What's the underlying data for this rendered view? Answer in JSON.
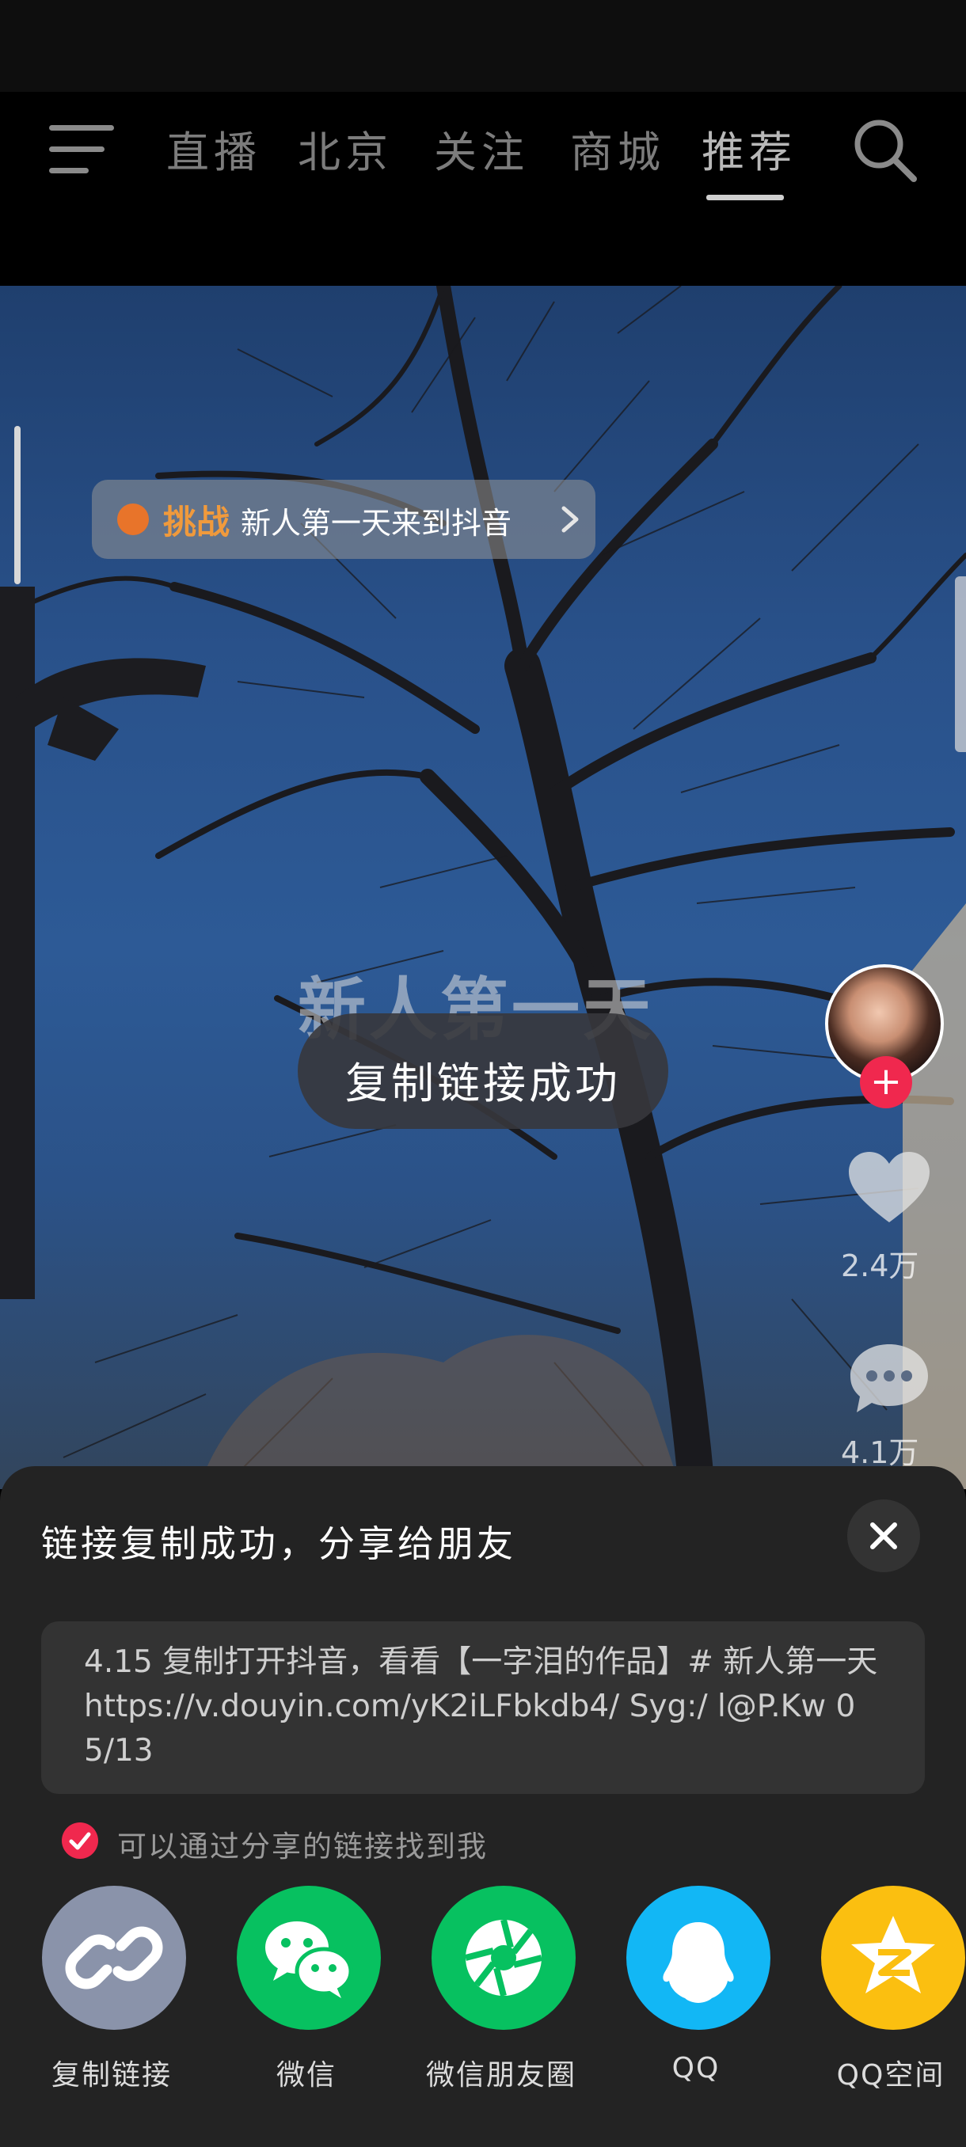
{
  "nav": {
    "tabs": [
      "直播",
      "北京",
      "关注",
      "商城",
      "推荐"
    ],
    "active_tab": "推荐",
    "menu_icon": "menu-icon",
    "search_icon": "search-icon"
  },
  "video": {
    "challenge_label": "挑战",
    "challenge_text": "新人第一天来到抖音",
    "overlay_title": "新人第一天",
    "toast": "复制链接成功",
    "like_count": "2.4万",
    "comment_count": "4.1万"
  },
  "share_sheet": {
    "title": "链接复制成功，分享给朋友",
    "link_text": "4.15 复制打开抖音，看看【一字泪的作品】# 新人第一天  https://v.douyin.com/yK2iLFbkdb4/ Syg:/ l@P.Kw 05/13",
    "checkbox_label": "可以通过分享的链接找到我",
    "checkbox_checked": true,
    "targets": [
      {
        "label": "复制链接",
        "color": "#8a93aa",
        "icon": "link-icon"
      },
      {
        "label": "微信",
        "color": "#07c160",
        "icon": "wechat-icon"
      },
      {
        "label": "微信朋友圈",
        "color": "#07c160",
        "icon": "moments-icon"
      },
      {
        "label": "QQ",
        "color": "#12b7f5",
        "icon": "qq-icon"
      },
      {
        "label": "QQ空间",
        "color": "#fbbf10",
        "icon": "qzone-icon"
      }
    ]
  },
  "colors": {
    "accent_red": "#f0284e",
    "challenge_orange": "#f09a3c",
    "sheet_bg": "#232323"
  }
}
